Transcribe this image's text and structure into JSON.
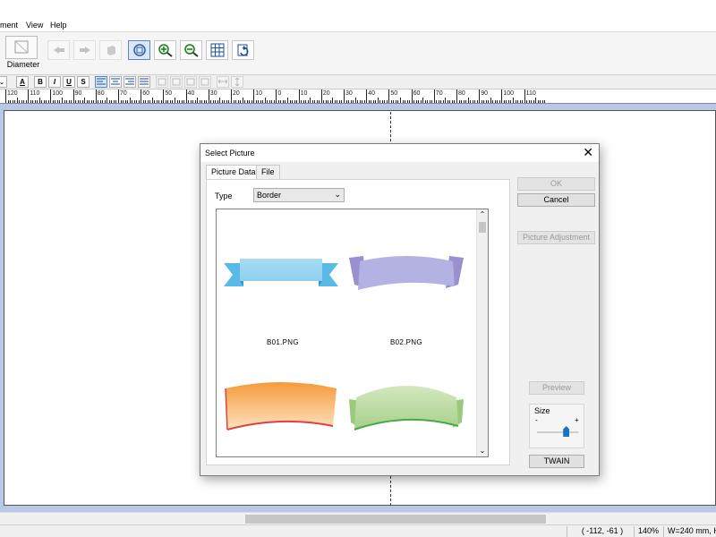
{
  "menu": {
    "items": [
      "ment",
      "View",
      "Help"
    ]
  },
  "toolbar": {
    "diameter_label": "Diameter",
    "buttons": [
      {
        "icon": "send-back-icon",
        "enabled": false
      },
      {
        "icon": "bring-front-icon",
        "enabled": false
      },
      {
        "icon": "box-3d-icon",
        "enabled": false
      },
      {
        "icon": "zoom-fit-icon",
        "enabled": true,
        "selected": true
      },
      {
        "icon": "zoom-in-icon",
        "enabled": true
      },
      {
        "icon": "zoom-out-icon",
        "enabled": true
      },
      {
        "icon": "grid-icon",
        "enabled": true
      },
      {
        "icon": "refresh-icon",
        "enabled": true
      }
    ]
  },
  "format_bar": {
    "buttons": [
      "A",
      "B",
      "I",
      "U",
      "S"
    ]
  },
  "ruler": {
    "labels": [
      "120",
      "110",
      "100",
      "90",
      "80",
      "70",
      "60",
      "50",
      "40",
      "30",
      "20",
      "10",
      "0",
      "10",
      "20",
      "30",
      "40",
      "50",
      "60",
      "70",
      "80",
      "90",
      "100",
      "110"
    ]
  },
  "dialog": {
    "title": "Select Picture",
    "close_glyph": "✕",
    "tabs": [
      "Picture Data",
      "File"
    ],
    "type_label": "Type",
    "type_value": "Border",
    "pictures": [
      {
        "caption": "B01.PNG",
        "kind": "ribbon-blue"
      },
      {
        "caption": "B02.PNG",
        "kind": "banner-purple"
      },
      {
        "caption": "",
        "kind": "banner-orange"
      },
      {
        "caption": "",
        "kind": "banner-green"
      }
    ],
    "ok_label": "OK",
    "cancel_label": "Cancel",
    "picture_adjustment_label": "Picture Adjustment",
    "preview_label": "Preview",
    "size_label": "Size",
    "size_minus": "-",
    "size_plus": "+",
    "size_value": 0.7,
    "twain_label": "TWAIN"
  },
  "status": {
    "coords": "( -112, -61 )",
    "zoom": "140%",
    "dimensions": "W=240 mm, H="
  },
  "colors": {
    "canvas_bg": "#b7c9e6",
    "accent": "#1a72c9"
  }
}
